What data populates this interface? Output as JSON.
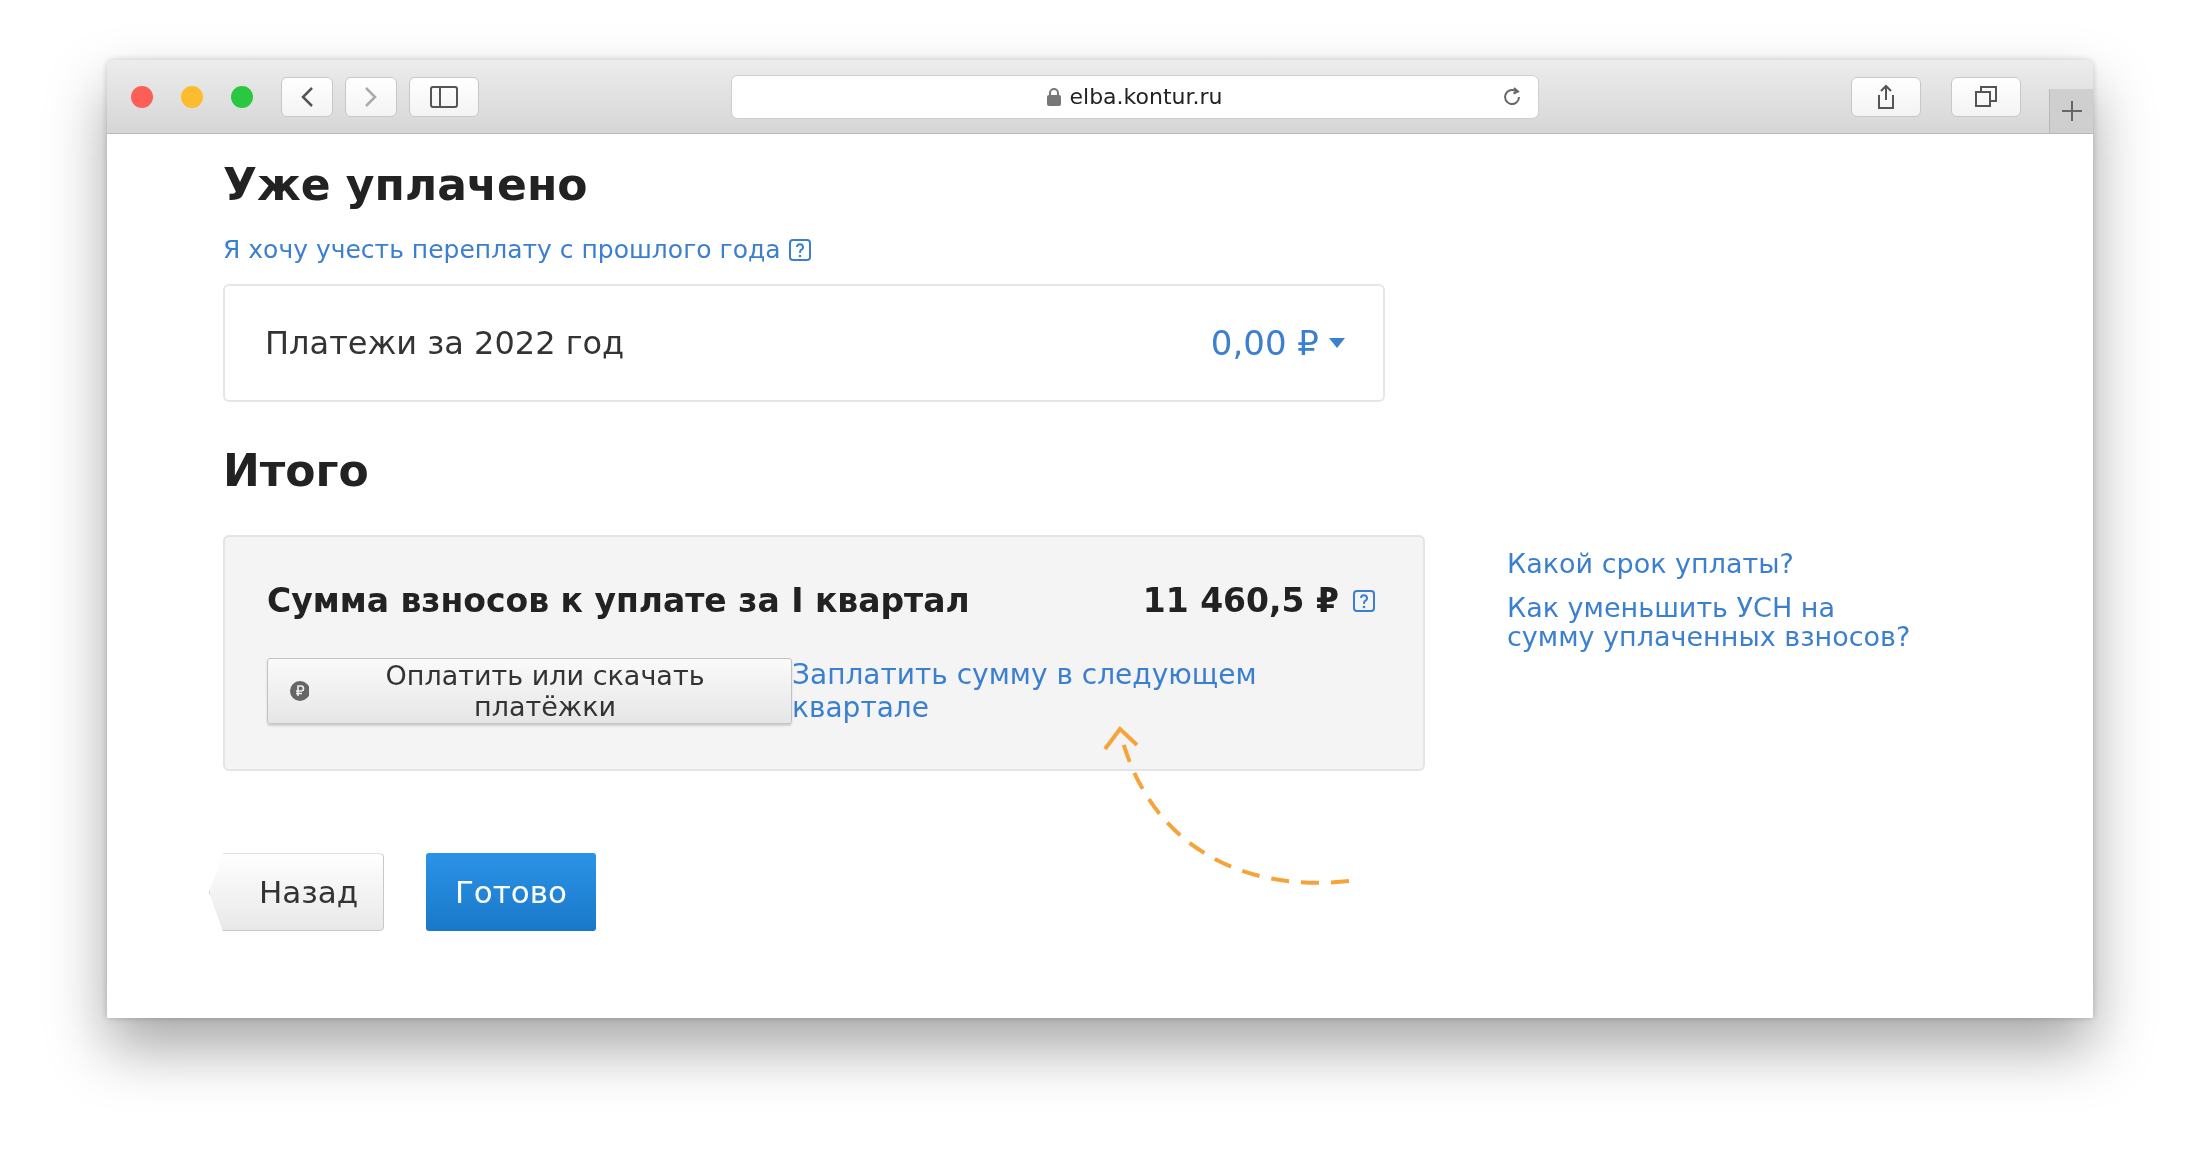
{
  "browser": {
    "url": "elba.kontur.ru"
  },
  "paid_section": {
    "title": "Уже уплачено",
    "overpayment_link": "Я хочу учесть переплату с прошлого года",
    "payments": {
      "label": "Платежи за 2022 год",
      "amount": "0,00 ₽"
    }
  },
  "total_section": {
    "title": "Итого",
    "summary": {
      "label": "Сумма взносов к уплате за I квартал",
      "amount": "11 460,5 ₽",
      "pay_button": "Оплатить или скачать платёжки",
      "defer_link": "Заплатить сумму в следующем квартале"
    }
  },
  "help_links": [
    "Какой срок уплаты?",
    "Как уменьшить УСН на сумму уплаченных взносов?"
  ],
  "buttons": {
    "back": "Назад",
    "done": "Готово"
  }
}
